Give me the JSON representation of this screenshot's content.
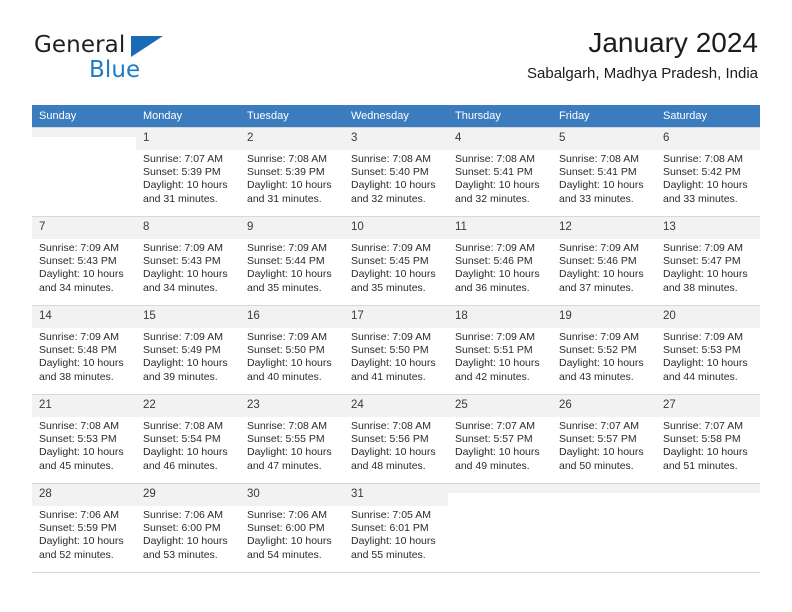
{
  "brand": {
    "name_part1": "General",
    "name_part2": "Blue",
    "accent_color": "#1f7ac4",
    "triangle_color": "#1a6bb5"
  },
  "header": {
    "title": "January 2024",
    "subtitle": "Sabalgarh, Madhya Pradesh, India"
  },
  "calendar": {
    "header_background": "#3b7cbf",
    "weekday_headers": [
      "Sunday",
      "Monday",
      "Tuesday",
      "Wednesday",
      "Thursday",
      "Friday",
      "Saturday"
    ],
    "weeks": [
      [
        {
          "day": "",
          "sunrise": "",
          "sunset": "",
          "daylight1": "",
          "daylight2": "",
          "empty": true
        },
        {
          "day": "1",
          "sunrise": "Sunrise: 7:07 AM",
          "sunset": "Sunset: 5:39 PM",
          "daylight1": "Daylight: 10 hours",
          "daylight2": "and 31 minutes."
        },
        {
          "day": "2",
          "sunrise": "Sunrise: 7:08 AM",
          "sunset": "Sunset: 5:39 PM",
          "daylight1": "Daylight: 10 hours",
          "daylight2": "and 31 minutes."
        },
        {
          "day": "3",
          "sunrise": "Sunrise: 7:08 AM",
          "sunset": "Sunset: 5:40 PM",
          "daylight1": "Daylight: 10 hours",
          "daylight2": "and 32 minutes."
        },
        {
          "day": "4",
          "sunrise": "Sunrise: 7:08 AM",
          "sunset": "Sunset: 5:41 PM",
          "daylight1": "Daylight: 10 hours",
          "daylight2": "and 32 minutes."
        },
        {
          "day": "5",
          "sunrise": "Sunrise: 7:08 AM",
          "sunset": "Sunset: 5:41 PM",
          "daylight1": "Daylight: 10 hours",
          "daylight2": "and 33 minutes."
        },
        {
          "day": "6",
          "sunrise": "Sunrise: 7:08 AM",
          "sunset": "Sunset: 5:42 PM",
          "daylight1": "Daylight: 10 hours",
          "daylight2": "and 33 minutes."
        }
      ],
      [
        {
          "day": "7",
          "sunrise": "Sunrise: 7:09 AM",
          "sunset": "Sunset: 5:43 PM",
          "daylight1": "Daylight: 10 hours",
          "daylight2": "and 34 minutes."
        },
        {
          "day": "8",
          "sunrise": "Sunrise: 7:09 AM",
          "sunset": "Sunset: 5:43 PM",
          "daylight1": "Daylight: 10 hours",
          "daylight2": "and 34 minutes."
        },
        {
          "day": "9",
          "sunrise": "Sunrise: 7:09 AM",
          "sunset": "Sunset: 5:44 PM",
          "daylight1": "Daylight: 10 hours",
          "daylight2": "and 35 minutes."
        },
        {
          "day": "10",
          "sunrise": "Sunrise: 7:09 AM",
          "sunset": "Sunset: 5:45 PM",
          "daylight1": "Daylight: 10 hours",
          "daylight2": "and 35 minutes."
        },
        {
          "day": "11",
          "sunrise": "Sunrise: 7:09 AM",
          "sunset": "Sunset: 5:46 PM",
          "daylight1": "Daylight: 10 hours",
          "daylight2": "and 36 minutes."
        },
        {
          "day": "12",
          "sunrise": "Sunrise: 7:09 AM",
          "sunset": "Sunset: 5:46 PM",
          "daylight1": "Daylight: 10 hours",
          "daylight2": "and 37 minutes."
        },
        {
          "day": "13",
          "sunrise": "Sunrise: 7:09 AM",
          "sunset": "Sunset: 5:47 PM",
          "daylight1": "Daylight: 10 hours",
          "daylight2": "and 38 minutes."
        }
      ],
      [
        {
          "day": "14",
          "sunrise": "Sunrise: 7:09 AM",
          "sunset": "Sunset: 5:48 PM",
          "daylight1": "Daylight: 10 hours",
          "daylight2": "and 38 minutes."
        },
        {
          "day": "15",
          "sunrise": "Sunrise: 7:09 AM",
          "sunset": "Sunset: 5:49 PM",
          "daylight1": "Daylight: 10 hours",
          "daylight2": "and 39 minutes."
        },
        {
          "day": "16",
          "sunrise": "Sunrise: 7:09 AM",
          "sunset": "Sunset: 5:50 PM",
          "daylight1": "Daylight: 10 hours",
          "daylight2": "and 40 minutes."
        },
        {
          "day": "17",
          "sunrise": "Sunrise: 7:09 AM",
          "sunset": "Sunset: 5:50 PM",
          "daylight1": "Daylight: 10 hours",
          "daylight2": "and 41 minutes."
        },
        {
          "day": "18",
          "sunrise": "Sunrise: 7:09 AM",
          "sunset": "Sunset: 5:51 PM",
          "daylight1": "Daylight: 10 hours",
          "daylight2": "and 42 minutes."
        },
        {
          "day": "19",
          "sunrise": "Sunrise: 7:09 AM",
          "sunset": "Sunset: 5:52 PM",
          "daylight1": "Daylight: 10 hours",
          "daylight2": "and 43 minutes."
        },
        {
          "day": "20",
          "sunrise": "Sunrise: 7:09 AM",
          "sunset": "Sunset: 5:53 PM",
          "daylight1": "Daylight: 10 hours",
          "daylight2": "and 44 minutes."
        }
      ],
      [
        {
          "day": "21",
          "sunrise": "Sunrise: 7:08 AM",
          "sunset": "Sunset: 5:53 PM",
          "daylight1": "Daylight: 10 hours",
          "daylight2": "and 45 minutes."
        },
        {
          "day": "22",
          "sunrise": "Sunrise: 7:08 AM",
          "sunset": "Sunset: 5:54 PM",
          "daylight1": "Daylight: 10 hours",
          "daylight2": "and 46 minutes."
        },
        {
          "day": "23",
          "sunrise": "Sunrise: 7:08 AM",
          "sunset": "Sunset: 5:55 PM",
          "daylight1": "Daylight: 10 hours",
          "daylight2": "and 47 minutes."
        },
        {
          "day": "24",
          "sunrise": "Sunrise: 7:08 AM",
          "sunset": "Sunset: 5:56 PM",
          "daylight1": "Daylight: 10 hours",
          "daylight2": "and 48 minutes."
        },
        {
          "day": "25",
          "sunrise": "Sunrise: 7:07 AM",
          "sunset": "Sunset: 5:57 PM",
          "daylight1": "Daylight: 10 hours",
          "daylight2": "and 49 minutes."
        },
        {
          "day": "26",
          "sunrise": "Sunrise: 7:07 AM",
          "sunset": "Sunset: 5:57 PM",
          "daylight1": "Daylight: 10 hours",
          "daylight2": "and 50 minutes."
        },
        {
          "day": "27",
          "sunrise": "Sunrise: 7:07 AM",
          "sunset": "Sunset: 5:58 PM",
          "daylight1": "Daylight: 10 hours",
          "daylight2": "and 51 minutes."
        }
      ],
      [
        {
          "day": "28",
          "sunrise": "Sunrise: 7:06 AM",
          "sunset": "Sunset: 5:59 PM",
          "daylight1": "Daylight: 10 hours",
          "daylight2": "and 52 minutes."
        },
        {
          "day": "29",
          "sunrise": "Sunrise: 7:06 AM",
          "sunset": "Sunset: 6:00 PM",
          "daylight1": "Daylight: 10 hours",
          "daylight2": "and 53 minutes."
        },
        {
          "day": "30",
          "sunrise": "Sunrise: 7:06 AM",
          "sunset": "Sunset: 6:00 PM",
          "daylight1": "Daylight: 10 hours",
          "daylight2": "and 54 minutes."
        },
        {
          "day": "31",
          "sunrise": "Sunrise: 7:05 AM",
          "sunset": "Sunset: 6:01 PM",
          "daylight1": "Daylight: 10 hours",
          "daylight2": "and 55 minutes."
        },
        {
          "day": "",
          "sunrise": "",
          "sunset": "",
          "daylight1": "",
          "daylight2": "",
          "empty": true
        },
        {
          "day": "",
          "sunrise": "",
          "sunset": "",
          "daylight1": "",
          "daylight2": "",
          "empty": true
        },
        {
          "day": "",
          "sunrise": "",
          "sunset": "",
          "daylight1": "",
          "daylight2": "",
          "empty": true
        }
      ]
    ]
  }
}
